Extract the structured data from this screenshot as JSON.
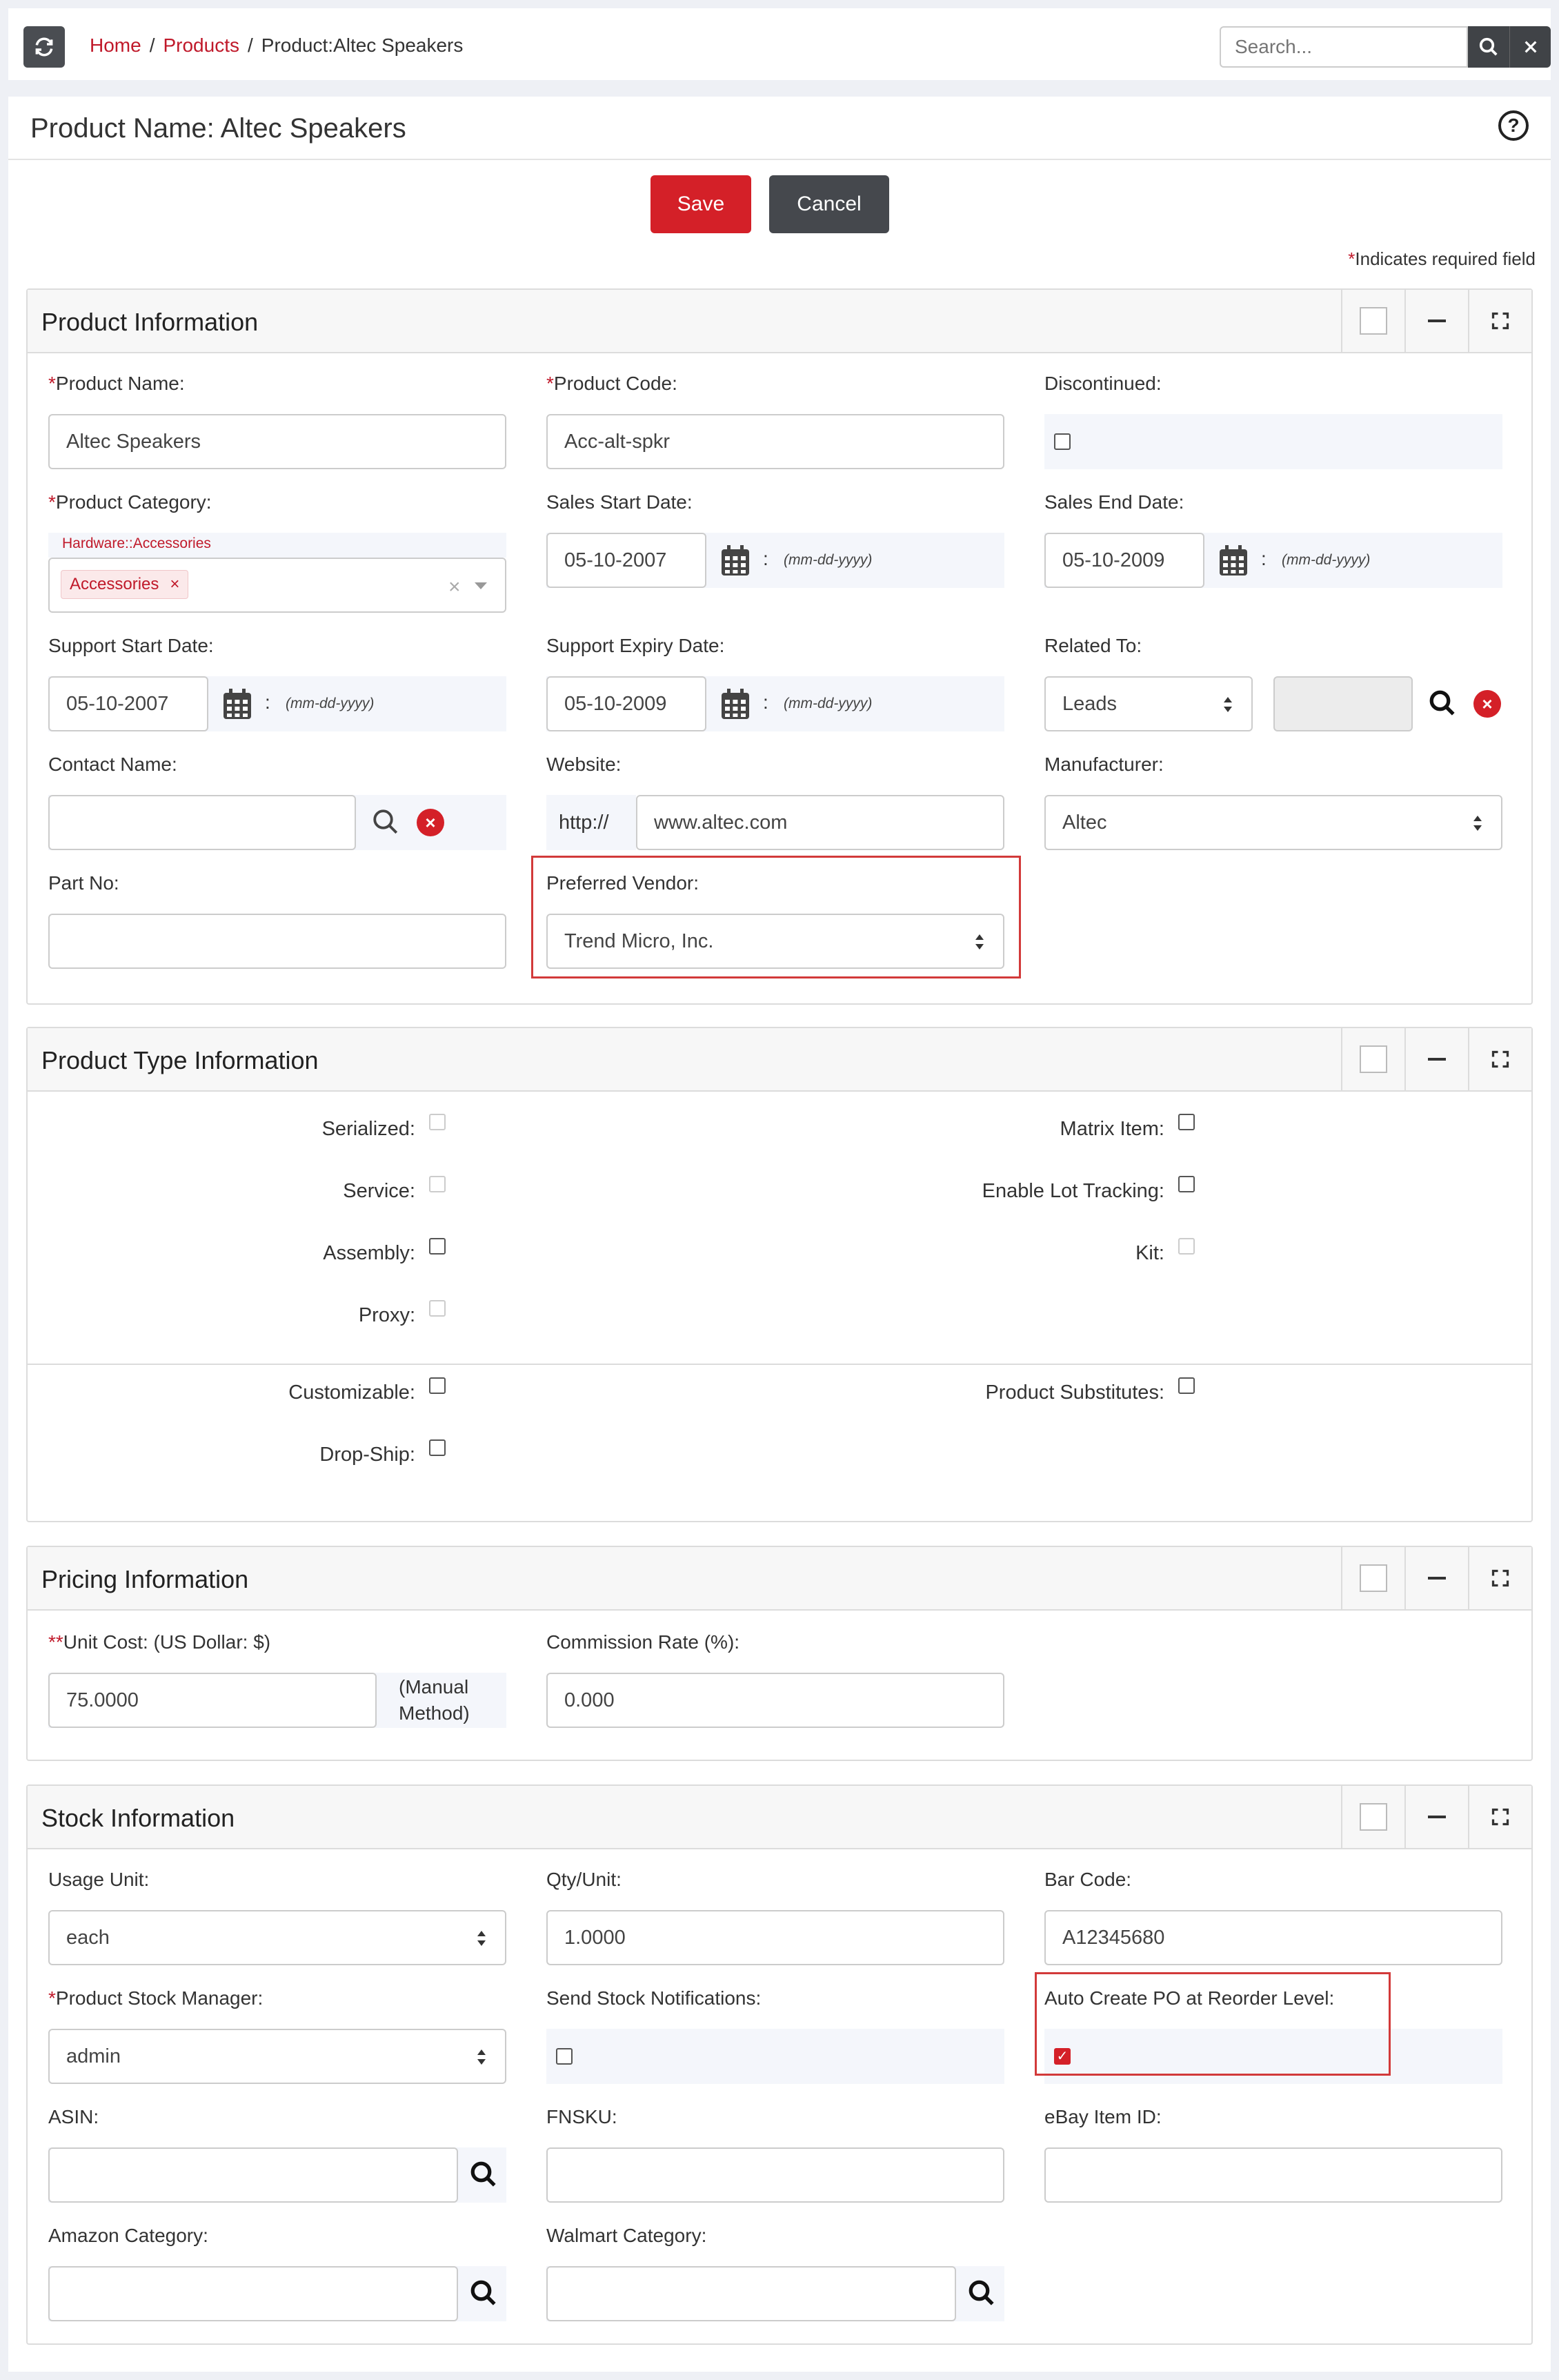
{
  "breadcrumb": {
    "home": "Home",
    "products": "Products",
    "current": "Product:Altec Speakers",
    "sep": "/"
  },
  "search": {
    "placeholder": "Search..."
  },
  "page": {
    "title": "Product Name: Altec Speakers",
    "help": "?"
  },
  "actions": {
    "save": "Save",
    "cancel": "Cancel"
  },
  "required_note": {
    "star": "*",
    "text": "Indicates required field"
  },
  "product_info": {
    "title": "Product Information",
    "product_name_label": "Product Name:",
    "product_name_value": "Altec Speakers",
    "product_code_label": "Product Code:",
    "product_code_value": "Acc-alt-spkr",
    "discontinued_label": "Discontinued:",
    "category_label": "Product Category:",
    "category_path": "Hardware::Accessories",
    "category_tag": "Accessories",
    "sales_start_label": "Sales Start Date:",
    "sales_start_value": "05-10-2007",
    "sales_end_label": "Sales End Date:",
    "sales_end_value": "05-10-2009",
    "date_format": "(mm-dd-yyyy)",
    "support_start_label": "Support Start Date:",
    "support_start_value": "05-10-2007",
    "support_expiry_label": "Support Expiry Date:",
    "support_expiry_value": "05-10-2009",
    "related_to_label": "Related To:",
    "related_to_value": "Leads",
    "contact_name_label": "Contact Name:",
    "website_label": "Website:",
    "website_prefix": "http://",
    "website_value": "www.altec.com",
    "manufacturer_label": "Manufacturer:",
    "manufacturer_value": "Altec",
    "part_no_label": "Part No:",
    "preferred_vendor_label": "Preferred Vendor:",
    "preferred_vendor_value": "Trend Micro, Inc."
  },
  "product_type": {
    "title": "Product Type Information",
    "serialized": "Serialized:",
    "service": "Service:",
    "assembly": "Assembly:",
    "proxy": "Proxy:",
    "matrix_item": "Matrix Item:",
    "lot_tracking": "Enable Lot Tracking:",
    "kit": "Kit:",
    "customizable": "Customizable:",
    "drop_ship": "Drop-Ship:",
    "substitutes": "Product Substitutes:"
  },
  "pricing": {
    "title": "Pricing Information",
    "unit_cost_stars": "**",
    "unit_cost_label": "Unit Cost:",
    "unit_cost_currency": "(US Dollar: $)",
    "unit_cost_value": "75.0000",
    "method_line1": "(Manual",
    "method_line2": "Method)",
    "commission_label": "Commission Rate (%):",
    "commission_value": "0.000"
  },
  "stock": {
    "title": "Stock Information",
    "usage_unit_label": "Usage Unit:",
    "usage_unit_value": "each",
    "qty_unit_label": "Qty/Unit:",
    "qty_unit_value": "1.0000",
    "bar_code_label": "Bar Code:",
    "bar_code_value": "A12345680",
    "stock_manager_label": "Product Stock Manager:",
    "stock_manager_value": "admin",
    "send_notifications_label": "Send Stock Notifications:",
    "auto_po_label": "Auto Create PO at Reorder Level:",
    "asin_label": "ASIN:",
    "fnsku_label": "FNSKU:",
    "ebay_label": "eBay Item ID:",
    "amazon_category_label": "Amazon Category:",
    "walmart_category_label": "Walmart Category:"
  }
}
